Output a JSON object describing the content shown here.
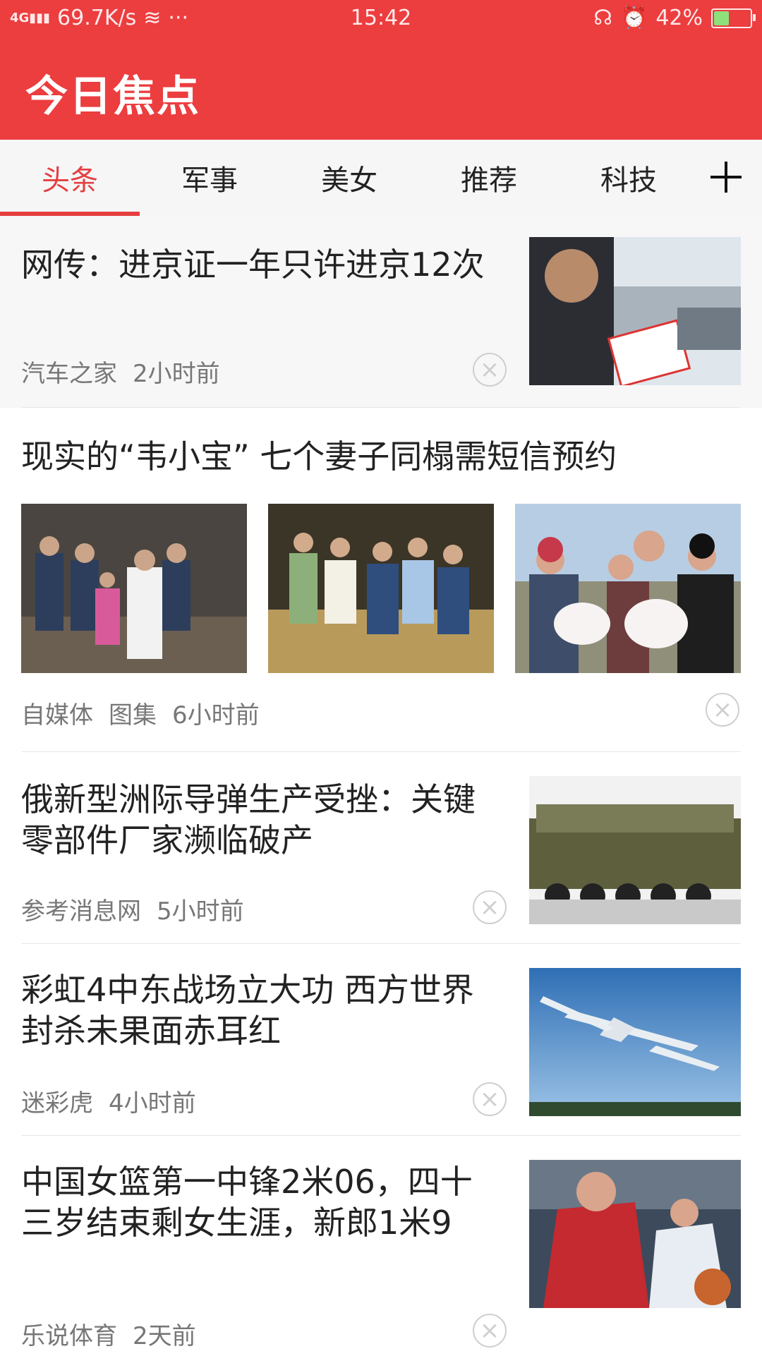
{
  "status_bar": {
    "network": "4G",
    "speed": "69.7K/s",
    "more": "···",
    "time": "15:42",
    "battery_percent": "42%",
    "battery_level": 0.42
  },
  "app": {
    "title": "今日焦点"
  },
  "tabs": [
    {
      "label": "头条",
      "active": true
    },
    {
      "label": "军事"
    },
    {
      "label": "美女"
    },
    {
      "label": "推荐"
    },
    {
      "label": "科技"
    }
  ],
  "feed": [
    {
      "title": "网传：进京证一年只许进京12次",
      "source": "汽车之家",
      "time": "2小时前",
      "thumbnail": "document-press-photo"
    },
    {
      "title": "现实的“韦小宝” 七个妻子同榻需短信预约",
      "source": "自媒体",
      "tag": "图集",
      "time": "6小时前",
      "images": [
        "family-group-photo",
        "family-on-hay-photo",
        "couple-with-babies-photo"
      ]
    },
    {
      "title": "俄新型洲际导弹生产受挫：关键零部件厂家濒临破产",
      "source": "参考消息网",
      "time": "5小时前",
      "thumbnail": "missile-truck-photo"
    },
    {
      "title": "彩虹4中东战场立大功 西方世界封杀未果面赤耳红",
      "source": "迷彩虎",
      "time": "4小时前",
      "thumbnail": "drone-sky-photo"
    },
    {
      "title": "中国女篮第一中锋2米06，四十三岁结束剩女生涯，新郎1米9",
      "source": "乐说体育",
      "time": "2天前",
      "thumbnail": "basketball-player-photo"
    }
  ],
  "colors": {
    "accent": "#ec3d3f",
    "tab_active": "#e53e40"
  }
}
